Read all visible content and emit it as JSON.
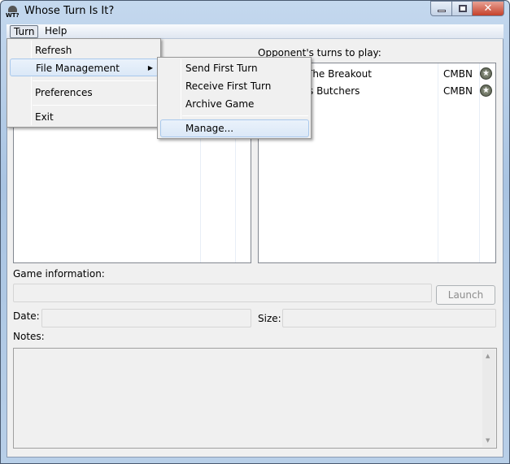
{
  "window": {
    "title": "Whose Turn Is It?",
    "icon": "helmet-wti-icon",
    "app_icon_text": "WT?"
  },
  "menubar": [
    "Turn",
    "Help"
  ],
  "opponent_list": {
    "label": "Opponent's turns to play:",
    "rows": [
      {
        "name": "The Breakout",
        "game": "CMBN",
        "icon": "star-badge-icon"
      },
      {
        "name": "s Butchers",
        "game": "CMBN",
        "icon": "star-badge-icon"
      }
    ]
  },
  "game_info": {
    "label": "Game information:",
    "value": "",
    "launch_label": "Launch"
  },
  "date": {
    "label": "Date:",
    "value": ""
  },
  "size": {
    "label": "Size:",
    "value": ""
  },
  "notes": {
    "label": "Notes:",
    "value": ""
  },
  "turn_menu": {
    "items": [
      "Refresh",
      "File Management",
      "Preferences",
      "Exit"
    ]
  },
  "file_submenu": {
    "items": [
      "Send First Turn",
      "Receive First Turn",
      "Archive Game",
      "Manage..."
    ]
  }
}
